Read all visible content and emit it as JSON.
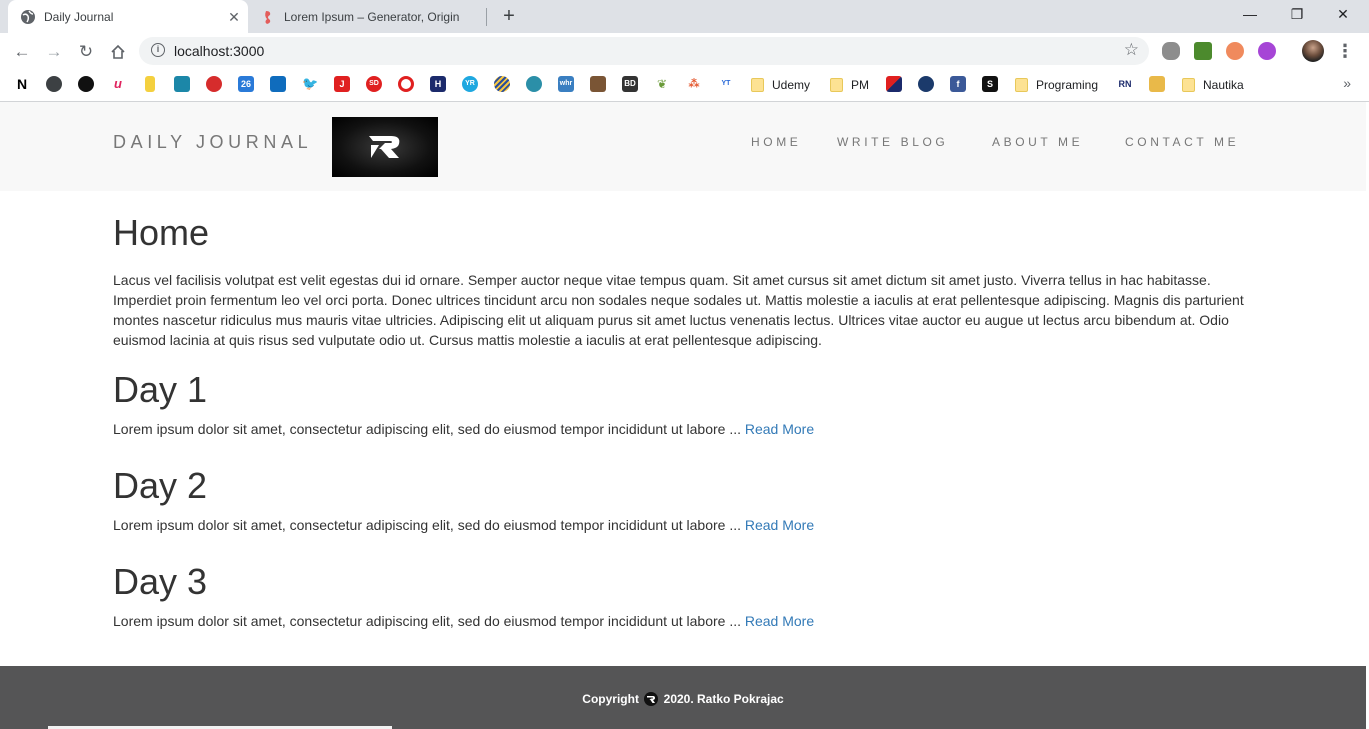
{
  "browser": {
    "tabs": [
      {
        "title": "Daily Journal",
        "active": true
      },
      {
        "title": "Lorem Ipsum – Generator, Origin",
        "active": false
      }
    ],
    "url": "localhost:3000",
    "bookmarks": {
      "folders": [
        "Udemy",
        "PM",
        "Programing",
        "Nautika"
      ],
      "icon_texts": {
        "n": "N",
        "d26": "26",
        "sd": "SD",
        "yr": "YR",
        "whr": "whr",
        "bd": "BD",
        "ytmp3": "YT"
      }
    }
  },
  "site": {
    "brand": "DAILY JOURNAL",
    "nav": [
      "HOME",
      "WRITE BLOG",
      "ABOUT ME",
      "CONTACT ME"
    ]
  },
  "main": {
    "title": "Home",
    "intro": "Lacus vel facilisis volutpat est velit egestas dui id ornare. Semper auctor neque vitae tempus quam. Sit amet cursus sit amet dictum sit amet justo. Viverra tellus in hac habitasse. Imperdiet proin fermentum leo vel orci porta. Donec ultrices tincidunt arcu non sodales neque sodales ut. Mattis molestie a iaculis at erat pellentesque adipiscing. Magnis dis parturient montes nascetur ridiculus mus mauris vitae ultricies. Adipiscing elit ut aliquam purus sit amet luctus venenatis lectus. Ultrices vitae auctor eu augue ut lectus arcu bibendum at. Odio euismod lacinia at quis risus sed vulputate odio ut. Cursus mattis molestie a iaculis at erat pellentesque adipiscing.",
    "posts": [
      {
        "title": "Day 1",
        "excerpt": "Lorem ipsum dolor sit amet, consectetur adipiscing elit, sed do eiusmod tempor incididunt ut labore ...",
        "link": "Read More"
      },
      {
        "title": "Day 2",
        "excerpt": "Lorem ipsum dolor sit amet, consectetur adipiscing elit, sed do eiusmod tempor incididunt ut labore ...",
        "link": "Read More"
      },
      {
        "title": "Day 3",
        "excerpt": "Lorem ipsum dolor sit amet, consectetur adipiscing elit, sed do eiusmod tempor incididunt ut labore ...",
        "link": "Read More"
      }
    ]
  },
  "footer": {
    "copyright_prefix": "Copyright",
    "copyright_suffix": "2020. Ratko Pokrajac"
  },
  "colors": {
    "link": "#337ab7",
    "nav_bg": "#f8f8f8",
    "footer_bg": "#555556",
    "text": "#333333"
  }
}
